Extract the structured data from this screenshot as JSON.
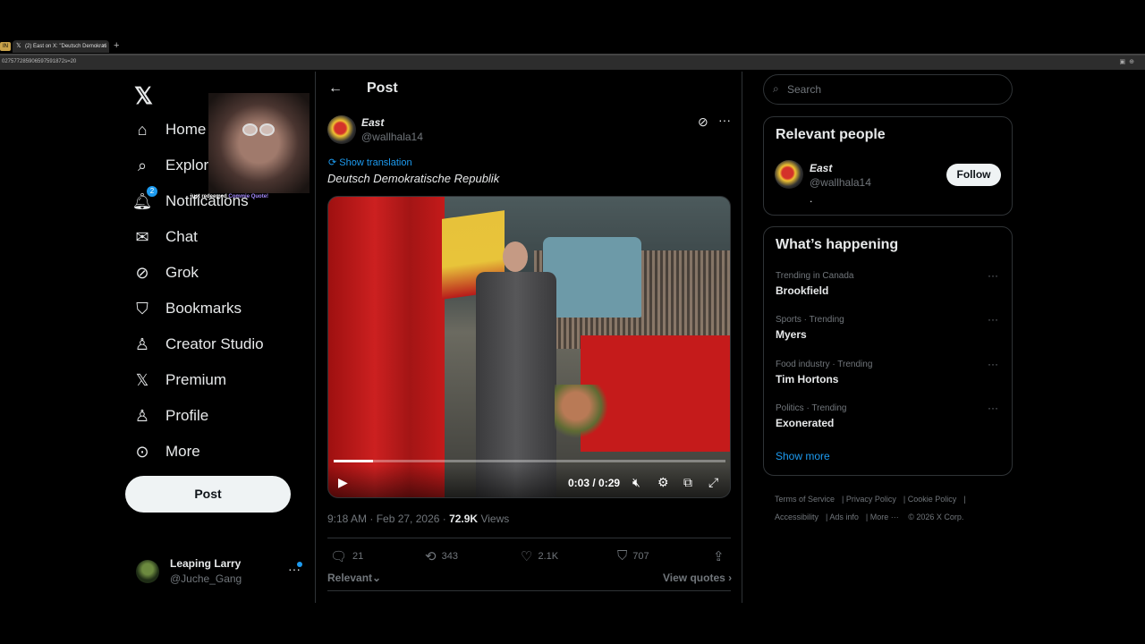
{
  "browser": {
    "tab_title": "(2) East on X: \"Deutsch Demokrati",
    "tab_pin_label": "IN",
    "new_tab": "+",
    "url": "027577285906597591872s=20"
  },
  "nav": {
    "items": [
      {
        "label": "Home",
        "icon": "home-icon"
      },
      {
        "label": "Explore",
        "icon": "search-icon"
      },
      {
        "label": "Notifications",
        "icon": "bell-icon",
        "badge": "2"
      },
      {
        "label": "Chat",
        "icon": "mail-icon"
      },
      {
        "label": "Grok",
        "icon": "grok-icon"
      },
      {
        "label": "Bookmarks",
        "icon": "bookmark-icon"
      },
      {
        "label": "Creator Studio",
        "icon": "creator-icon"
      },
      {
        "label": "Premium",
        "icon": "x-icon"
      },
      {
        "label": "Profile",
        "icon": "person-icon"
      },
      {
        "label": "More",
        "icon": "more-circle-icon"
      }
    ],
    "post_button": "Post"
  },
  "account": {
    "name": "Leaping Larry",
    "handle": "@Juche_Gang"
  },
  "overlay": {
    "caption_user": "                ",
    "caption_mid": "just redeemed",
    "caption_reward": "Commie Quote!"
  },
  "main": {
    "header_title": "Post",
    "post": {
      "author_name": "East",
      "author_handle": "@wallhala14",
      "translate_label": "Show translation",
      "text": "Deutsch Demokratische Republik",
      "video": {
        "current_time": "0:03",
        "duration": "0:29",
        "time_label": "0:03 / 0:29",
        "progress": 0.1
      },
      "timestamp": "9:18 AM · Feb 27, 2026 · ",
      "views_count": "72.9K",
      "views_label": " Views",
      "actions": {
        "replies": "21",
        "reposts": "343",
        "likes": "2.1K",
        "bookmarks": "707"
      },
      "sort_label": "Relevant",
      "view_quotes": "View quotes"
    }
  },
  "sidebar": {
    "search_placeholder": "Search",
    "relevant_people": {
      "title": "Relevant people",
      "name": "East",
      "handle": "@wallhala14",
      "bio": ".",
      "follow_label": "Follow"
    },
    "whats_happening": {
      "title": "What’s happening",
      "trends": [
        {
          "context": "Trending in Canada",
          "name": "Brookfield"
        },
        {
          "context": "Sports · Trending",
          "name": "Myers"
        },
        {
          "context": "Food industry · Trending",
          "name": "Tim Hortons"
        },
        {
          "context": "Politics · Trending",
          "name": "Exonerated"
        }
      ],
      "show_more": "Show more"
    },
    "footer": [
      "Terms of Service",
      "Privacy Policy",
      "Cookie Policy",
      "Accessibility",
      "Ads info",
      "More ···",
      "© 2026 X Corp."
    ]
  },
  "colors": {
    "accent": "#1d9bf0",
    "background": "#000000",
    "border": "#2f3336",
    "muted_text": "#71767b"
  }
}
